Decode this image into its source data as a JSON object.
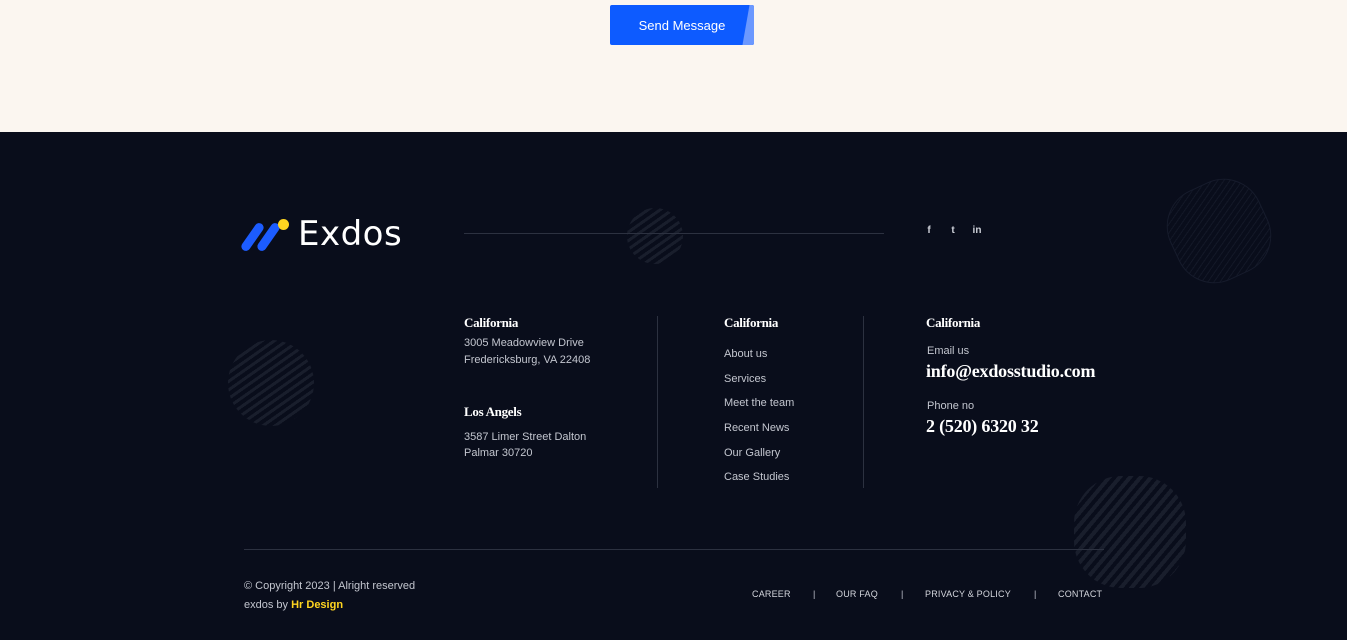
{
  "contact_form": {
    "submit_label": "Send Message"
  },
  "brand": {
    "name": "Exdos",
    "accent": "#1c5cff",
    "dot": "#ffd520"
  },
  "social": [
    {
      "icon": "facebook-icon",
      "glyph": "f"
    },
    {
      "icon": "twitter-icon",
      "glyph": "t"
    },
    {
      "icon": "linkedin-icon",
      "glyph": "in"
    }
  ],
  "addresses": {
    "california": {
      "title": "California",
      "line1": "3005 Meadowview Drive",
      "line2": "Fredericksburg, VA 22408"
    },
    "los_angels": {
      "title": "Los Angels",
      "line1": "3587 Limer Street Dalton",
      "line2": "Palmar 30720"
    }
  },
  "links": {
    "title": "California",
    "items": [
      "About us",
      "Services",
      "Meet the team",
      "Recent News",
      "Our Gallery",
      "Case Studies"
    ]
  },
  "contact": {
    "title": "California",
    "email_label": "Email us",
    "email": "info@exdosstudio.com",
    "phone_label": "Phone no",
    "phone": "2 (520) 6320 32"
  },
  "copyright": {
    "line1": "© Copyright 2023 | Alright reserved",
    "line2_prefix": "exdos by ",
    "line2_link": "Hr Design"
  },
  "bottom_nav": [
    "CAREER",
    "OUR FAQ",
    "PRIVACY & POLICY",
    "CONTACT"
  ],
  "separator": "|"
}
